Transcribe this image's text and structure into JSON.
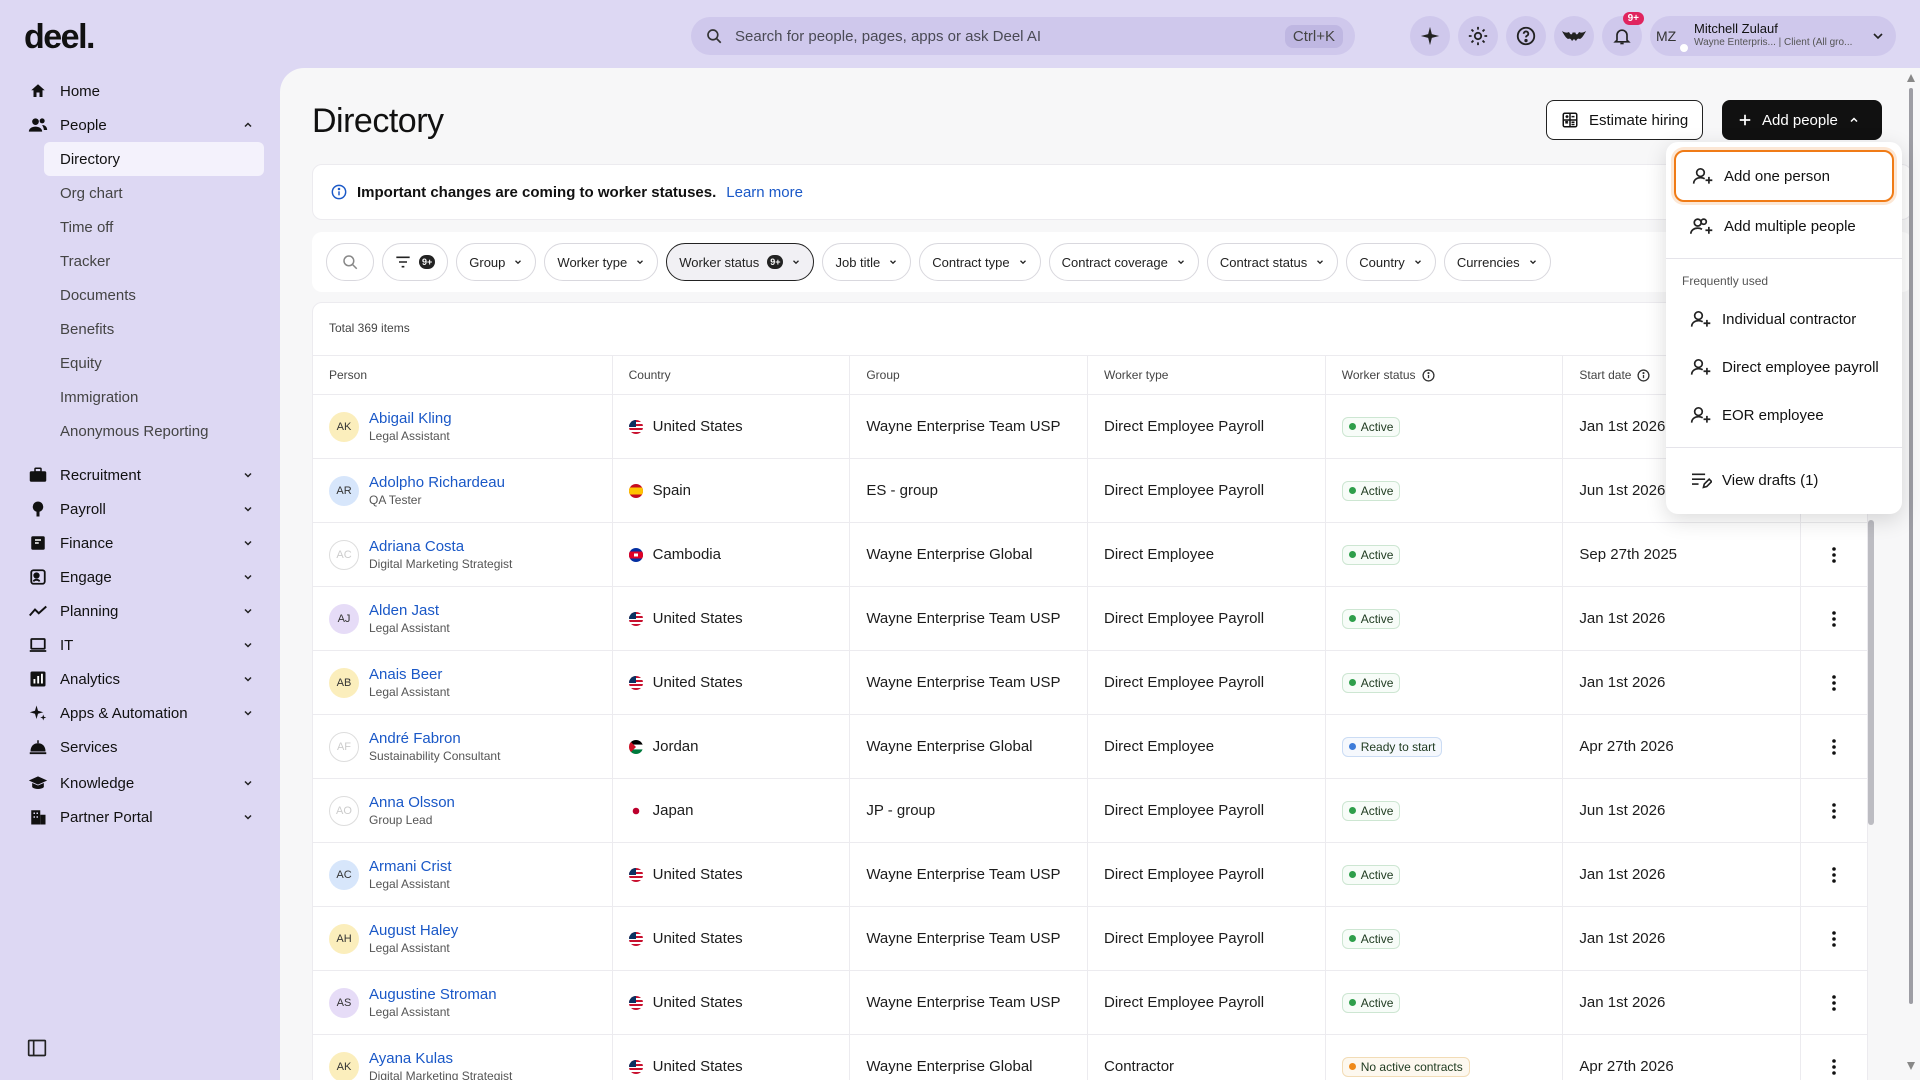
{
  "app": {
    "logo": "deel",
    "logo_dot": "."
  },
  "search": {
    "placeholder": "Search for people, pages, apps or ask Deel AI",
    "shortcut": "Ctrl+K"
  },
  "notifications": {
    "badge": "9+"
  },
  "user": {
    "initials": "MZ",
    "name": "Mitchell Zulauf",
    "org": "Wayne Enterpris... | Client (All gro..."
  },
  "sidebar": {
    "items": [
      {
        "label": "Home"
      },
      {
        "label": "People"
      },
      {
        "label": "Recruitment"
      },
      {
        "label": "Payroll"
      },
      {
        "label": "Finance"
      },
      {
        "label": "Engage"
      },
      {
        "label": "Planning"
      },
      {
        "label": "IT"
      },
      {
        "label": "Analytics"
      },
      {
        "label": "Apps & Automation"
      },
      {
        "label": "Services"
      },
      {
        "label": "Knowledge"
      },
      {
        "label": "Partner Portal"
      }
    ],
    "people_sub": [
      "Directory",
      "Org chart",
      "Time off",
      "Tracker",
      "Documents",
      "Benefits",
      "Equity",
      "Immigration",
      "Anonymous Reporting"
    ]
  },
  "page": {
    "title": "Directory",
    "estimate_label": "Estimate hiring",
    "add_label": "Add people",
    "notice_text": "Important changes are coming to worker statuses.",
    "notice_link": "Learn more"
  },
  "filters": {
    "count_badge": "9+",
    "chips": [
      "Group",
      "Worker type",
      "Worker status",
      "Job title",
      "Contract type",
      "Contract coverage",
      "Contract status",
      "Country",
      "Currencies"
    ],
    "status_badge": "9+"
  },
  "table": {
    "total": "Total 369 items",
    "headers": [
      "Person",
      "Country",
      "Group",
      "Worker type",
      "Worker status",
      "Start date"
    ],
    "rows": [
      {
        "initials": "AK",
        "name": "Abigail Kling",
        "role": "Legal Assistant",
        "country": "United States",
        "group": "Wayne Enterprise Team USP",
        "type": "Direct Employee Payroll",
        "status": "Active",
        "start": "Jan 1st 2026"
      },
      {
        "initials": "AR",
        "name": "Adolpho Richardeau",
        "role": "QA Tester",
        "country": "Spain",
        "group": "ES - group",
        "type": "Direct Employee Payroll",
        "status": "Active",
        "start": "Jun 1st 2026"
      },
      {
        "initials": "AC",
        "name": "Adriana Costa",
        "role": "Digital Marketing Strategist",
        "country": "Cambodia",
        "group": "Wayne Enterprise Global",
        "type": "Direct Employee",
        "status": "Active",
        "start": "Sep 27th 2025"
      },
      {
        "initials": "AJ",
        "name": "Alden Jast",
        "role": "Legal Assistant",
        "country": "United States",
        "group": "Wayne Enterprise Team USP",
        "type": "Direct Employee Payroll",
        "status": "Active",
        "start": "Jan 1st 2026"
      },
      {
        "initials": "AB",
        "name": "Anais Beer",
        "role": "Legal Assistant",
        "country": "United States",
        "group": "Wayne Enterprise Team USP",
        "type": "Direct Employee Payroll",
        "status": "Active",
        "start": "Jan 1st 2026"
      },
      {
        "initials": "AF",
        "name": "André Fabron",
        "role": "Sustainability Consultant",
        "country": "Jordan",
        "group": "Wayne Enterprise Global",
        "type": "Direct Employee",
        "status": "Ready to start",
        "start": "Apr 27th 2026"
      },
      {
        "initials": "AO",
        "name": "Anna Olsson",
        "role": "Group Lead",
        "country": "Japan",
        "group": "JP - group",
        "type": "Direct Employee Payroll",
        "status": "Active",
        "start": "Jun 1st 2026"
      },
      {
        "initials": "AC",
        "name": "Armani Crist",
        "role": "Legal Assistant",
        "country": "United States",
        "group": "Wayne Enterprise Team USP",
        "type": "Direct Employee Payroll",
        "status": "Active",
        "start": "Jan 1st 2026"
      },
      {
        "initials": "AH",
        "name": "August Haley",
        "role": "Legal Assistant",
        "country": "United States",
        "group": "Wayne Enterprise Team USP",
        "type": "Direct Employee Payroll",
        "status": "Active",
        "start": "Jan 1st 2026"
      },
      {
        "initials": "AS",
        "name": "Augustine Stroman",
        "role": "Legal Assistant",
        "country": "United States",
        "group": "Wayne Enterprise Team USP",
        "type": "Direct Employee Payroll",
        "status": "Active",
        "start": "Jan 1st 2026"
      },
      {
        "initials": "AK",
        "name": "Ayana Kulas",
        "role": "Digital Marketing Strategist",
        "country": "United States",
        "group": "Wayne Enterprise Global",
        "type": "Contractor",
        "status": "No active contracts",
        "start": "Apr 27th 2026"
      }
    ]
  },
  "dropdown": {
    "add_one": "Add one person",
    "add_multiple": "Add multiple people",
    "frequently_used": "Frequently used",
    "individual": "Individual contractor",
    "direct_payroll": "Direct employee payroll",
    "eor": "EOR employee",
    "drafts": "View drafts (1)"
  },
  "colors": {
    "accent": "#1a58c7",
    "highlight": "#f07b16",
    "background": "#ddd8f3"
  }
}
